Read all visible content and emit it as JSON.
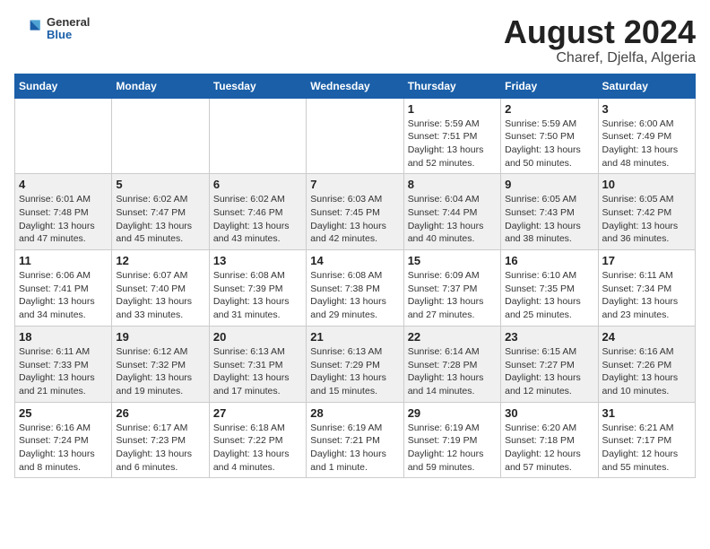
{
  "logo": {
    "general": "General",
    "blue": "Blue"
  },
  "title": "August 2024",
  "subtitle": "Charef, Djelfa, Algeria",
  "days_of_week": [
    "Sunday",
    "Monday",
    "Tuesday",
    "Wednesday",
    "Thursday",
    "Friday",
    "Saturday"
  ],
  "weeks": [
    [
      {
        "day": "",
        "info": ""
      },
      {
        "day": "",
        "info": ""
      },
      {
        "day": "",
        "info": ""
      },
      {
        "day": "",
        "info": ""
      },
      {
        "day": "1",
        "info": "Sunrise: 5:59 AM\nSunset: 7:51 PM\nDaylight: 13 hours\nand 52 minutes."
      },
      {
        "day": "2",
        "info": "Sunrise: 5:59 AM\nSunset: 7:50 PM\nDaylight: 13 hours\nand 50 minutes."
      },
      {
        "day": "3",
        "info": "Sunrise: 6:00 AM\nSunset: 7:49 PM\nDaylight: 13 hours\nand 48 minutes."
      }
    ],
    [
      {
        "day": "4",
        "info": "Sunrise: 6:01 AM\nSunset: 7:48 PM\nDaylight: 13 hours\nand 47 minutes."
      },
      {
        "day": "5",
        "info": "Sunrise: 6:02 AM\nSunset: 7:47 PM\nDaylight: 13 hours\nand 45 minutes."
      },
      {
        "day": "6",
        "info": "Sunrise: 6:02 AM\nSunset: 7:46 PM\nDaylight: 13 hours\nand 43 minutes."
      },
      {
        "day": "7",
        "info": "Sunrise: 6:03 AM\nSunset: 7:45 PM\nDaylight: 13 hours\nand 42 minutes."
      },
      {
        "day": "8",
        "info": "Sunrise: 6:04 AM\nSunset: 7:44 PM\nDaylight: 13 hours\nand 40 minutes."
      },
      {
        "day": "9",
        "info": "Sunrise: 6:05 AM\nSunset: 7:43 PM\nDaylight: 13 hours\nand 38 minutes."
      },
      {
        "day": "10",
        "info": "Sunrise: 6:05 AM\nSunset: 7:42 PM\nDaylight: 13 hours\nand 36 minutes."
      }
    ],
    [
      {
        "day": "11",
        "info": "Sunrise: 6:06 AM\nSunset: 7:41 PM\nDaylight: 13 hours\nand 34 minutes."
      },
      {
        "day": "12",
        "info": "Sunrise: 6:07 AM\nSunset: 7:40 PM\nDaylight: 13 hours\nand 33 minutes."
      },
      {
        "day": "13",
        "info": "Sunrise: 6:08 AM\nSunset: 7:39 PM\nDaylight: 13 hours\nand 31 minutes."
      },
      {
        "day": "14",
        "info": "Sunrise: 6:08 AM\nSunset: 7:38 PM\nDaylight: 13 hours\nand 29 minutes."
      },
      {
        "day": "15",
        "info": "Sunrise: 6:09 AM\nSunset: 7:37 PM\nDaylight: 13 hours\nand 27 minutes."
      },
      {
        "day": "16",
        "info": "Sunrise: 6:10 AM\nSunset: 7:35 PM\nDaylight: 13 hours\nand 25 minutes."
      },
      {
        "day": "17",
        "info": "Sunrise: 6:11 AM\nSunset: 7:34 PM\nDaylight: 13 hours\nand 23 minutes."
      }
    ],
    [
      {
        "day": "18",
        "info": "Sunrise: 6:11 AM\nSunset: 7:33 PM\nDaylight: 13 hours\nand 21 minutes."
      },
      {
        "day": "19",
        "info": "Sunrise: 6:12 AM\nSunset: 7:32 PM\nDaylight: 13 hours\nand 19 minutes."
      },
      {
        "day": "20",
        "info": "Sunrise: 6:13 AM\nSunset: 7:31 PM\nDaylight: 13 hours\nand 17 minutes."
      },
      {
        "day": "21",
        "info": "Sunrise: 6:13 AM\nSunset: 7:29 PM\nDaylight: 13 hours\nand 15 minutes."
      },
      {
        "day": "22",
        "info": "Sunrise: 6:14 AM\nSunset: 7:28 PM\nDaylight: 13 hours\nand 14 minutes."
      },
      {
        "day": "23",
        "info": "Sunrise: 6:15 AM\nSunset: 7:27 PM\nDaylight: 13 hours\nand 12 minutes."
      },
      {
        "day": "24",
        "info": "Sunrise: 6:16 AM\nSunset: 7:26 PM\nDaylight: 13 hours\nand 10 minutes."
      }
    ],
    [
      {
        "day": "25",
        "info": "Sunrise: 6:16 AM\nSunset: 7:24 PM\nDaylight: 13 hours\nand 8 minutes."
      },
      {
        "day": "26",
        "info": "Sunrise: 6:17 AM\nSunset: 7:23 PM\nDaylight: 13 hours\nand 6 minutes."
      },
      {
        "day": "27",
        "info": "Sunrise: 6:18 AM\nSunset: 7:22 PM\nDaylight: 13 hours\nand 4 minutes."
      },
      {
        "day": "28",
        "info": "Sunrise: 6:19 AM\nSunset: 7:21 PM\nDaylight: 13 hours\nand 1 minute."
      },
      {
        "day": "29",
        "info": "Sunrise: 6:19 AM\nSunset: 7:19 PM\nDaylight: 12 hours\nand 59 minutes."
      },
      {
        "day": "30",
        "info": "Sunrise: 6:20 AM\nSunset: 7:18 PM\nDaylight: 12 hours\nand 57 minutes."
      },
      {
        "day": "31",
        "info": "Sunrise: 6:21 AM\nSunset: 7:17 PM\nDaylight: 12 hours\nand 55 minutes."
      }
    ]
  ]
}
